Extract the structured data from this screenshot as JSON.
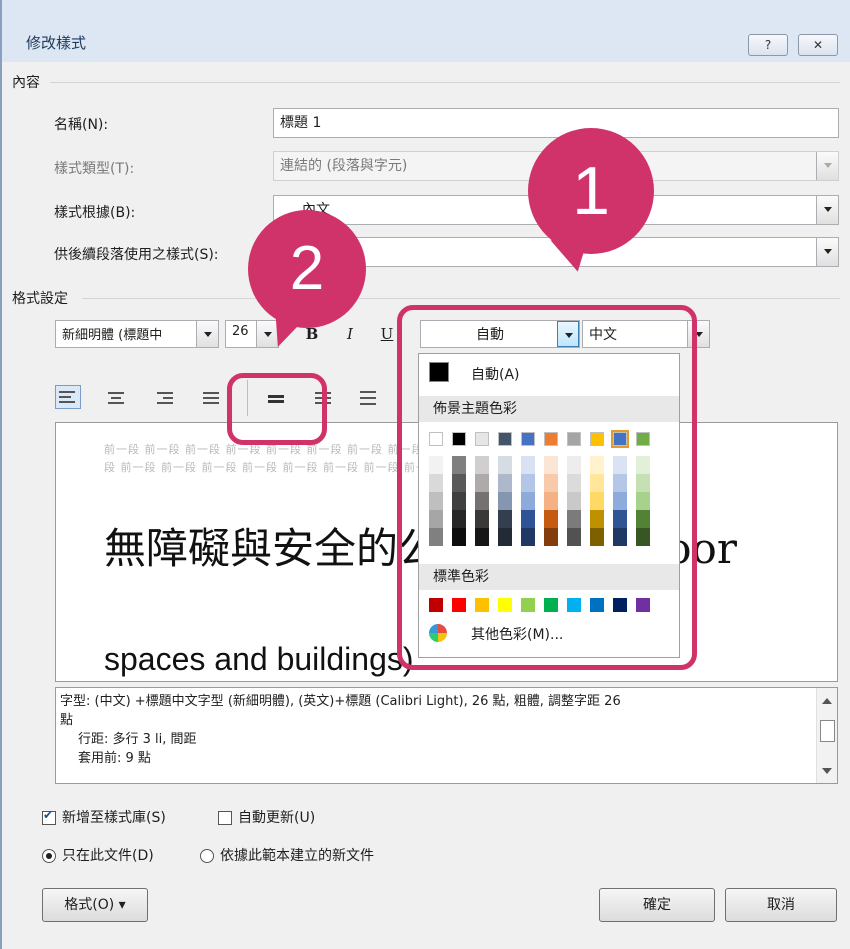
{
  "window": {
    "title": "修改樣式",
    "help_label": "?",
    "close_label": "✕"
  },
  "content_group": {
    "label": "內容",
    "name_label": "名稱(N):",
    "name_value": "標題 1",
    "type_label": "樣式類型(T):",
    "type_value": "連結的 (段落與字元)",
    "based_on_label": "樣式根據(B):",
    "based_on_value": "內文",
    "following_label": "供後續段落使用之樣式(S):",
    "following_value": ""
  },
  "format_group": {
    "label": "格式設定",
    "font_value": "新細明體 (標題中",
    "size_value": "26",
    "bold_label": "B",
    "italic_label": "I",
    "underline_label": "U",
    "color_value": "自動",
    "script_value": "中文"
  },
  "preview": {
    "ghost_line1": "前一段 前一段 前一段 前一段 前一段 前一段 前一段 前一段 前一段 前一段 前一段 前一段 前一段",
    "ghost_line2": "段 前一段 前一段 前一段 前一段 前一段 前一段 前一段 前一段 前一段 前一段 前一段 前一段",
    "main_text": "無障礙與安全的公共空間 (Indoor",
    "main_text2": "spaces and buildings)"
  },
  "description": {
    "line1": "字型: (中文) +標題中文字型 (新細明體), (英文)+標題 (Calibri Light), 26 點, 粗體, 調整字距 26",
    "line2": "點",
    "line3": "行距: 多行 3 li, 間距",
    "line4": "套用前: 9 點"
  },
  "options": {
    "add_gallery": "新增至樣式庫(S)",
    "auto_update": "自動更新(U)",
    "this_doc": "只在此文件(D)",
    "new_docs": "依據此範本建立的新文件"
  },
  "buttons": {
    "format": "格式(O) ▾",
    "ok": "確定",
    "cancel": "取消"
  },
  "color_palette": {
    "automatic_label": "自動(A)",
    "theme_header": "佈景主題色彩",
    "standard_header": "標準色彩",
    "more_colors": "其他色彩(M)...",
    "theme_colors": [
      "#ffffff",
      "#000000",
      "#e7e6e6",
      "#44546a",
      "#4472c4",
      "#ed7d31",
      "#a5a5a5",
      "#ffc000",
      "#4472c4",
      "#70ad47"
    ],
    "theme_shades": [
      [
        "#f2f2f2",
        "#d9d9d9",
        "#bfbfbf",
        "#a6a6a6",
        "#808080"
      ],
      [
        "#7f7f7f",
        "#595959",
        "#404040",
        "#262626",
        "#0d0d0d"
      ],
      [
        "#d0cece",
        "#aeaaaa",
        "#757171",
        "#3b3838",
        "#171616"
      ],
      [
        "#d6dce4",
        "#adb9ca",
        "#8496b0",
        "#333f4f",
        "#222a35"
      ],
      [
        "#d9e2f3",
        "#b4c6e7",
        "#8eaadb",
        "#2f5496",
        "#1f3864"
      ],
      [
        "#fbe5d5",
        "#f7caac",
        "#f4b183",
        "#c55a11",
        "#833c0b"
      ],
      [
        "#ededed",
        "#dbdbdb",
        "#c9c9c9",
        "#7b7b7b",
        "#525252"
      ],
      [
        "#fff2cc",
        "#ffe699",
        "#ffd966",
        "#bf9000",
        "#7f6000"
      ],
      [
        "#dae3f3",
        "#b4c7e7",
        "#8faadc",
        "#2f5597",
        "#203864"
      ],
      [
        "#e2efd9",
        "#c5e0b3",
        "#a9d18e",
        "#548235",
        "#375623"
      ]
    ],
    "standard_colors": [
      "#c00000",
      "#ff0000",
      "#ffc000",
      "#ffff00",
      "#92d050",
      "#00b050",
      "#00b0f0",
      "#0070c0",
      "#002060",
      "#7030a0"
    ]
  },
  "callouts": {
    "one": "1",
    "two": "2",
    "accent": "#d0336a"
  }
}
